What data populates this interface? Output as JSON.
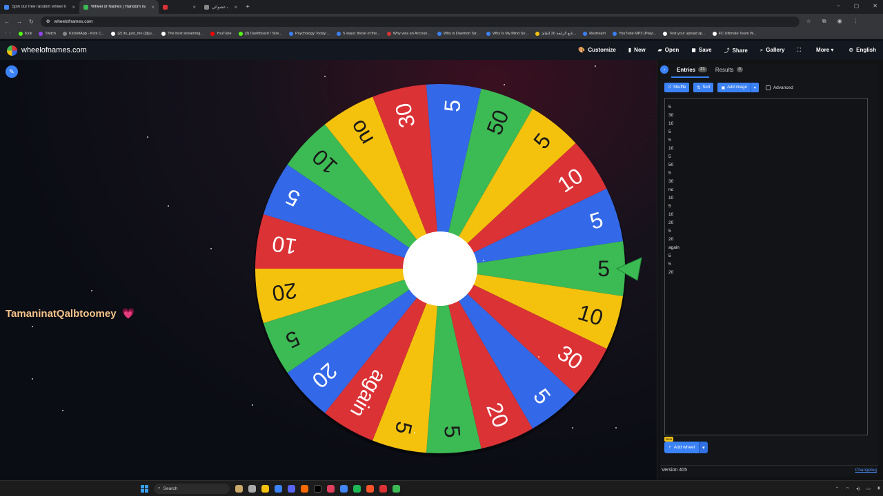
{
  "browser": {
    "tabs": [
      {
        "title": "Spin our free random wheel fo",
        "color": "#4285f4",
        "active": false
      },
      {
        "title": "Wheel of Names | Random nam",
        "color": "#3cba54",
        "active": true
      },
      {
        "title": "",
        "color": "#db3236",
        "active": false
      },
      {
        "title": "سحب عشوائي",
        "color": "#888888",
        "active": false
      }
    ],
    "url": "wheelofnames.com",
    "bookmarks": [
      {
        "label": "Kick",
        "color": "#53fc18"
      },
      {
        "label": "Twitch",
        "color": "#9146ff"
      },
      {
        "label": "KickletApp - Kick C...",
        "color": "#888888"
      },
      {
        "label": "(2) its_just_me (@ju...",
        "color": "#ffffff"
      },
      {
        "label": "The best streaming...",
        "color": "#ffffff"
      },
      {
        "label": "YouTube",
        "color": "#ff0000"
      },
      {
        "label": "(3) Dashboard / Stre...",
        "color": "#53fc18"
      },
      {
        "label": "Psychology Today:...",
        "color": "#3b82f6"
      },
      {
        "label": "5 ways: those of the...",
        "color": "#3b82f6"
      },
      {
        "label": "Why was an Accoun...",
        "color": "#db3236"
      },
      {
        "label": "Why is Daemon Tar...",
        "color": "#3b82f6"
      },
      {
        "label": "Why Is My Mind So...",
        "color": "#3b82f6"
      },
      {
        "label": "تابع الرابعة 20 للقائ...",
        "color": "#f4c20d"
      },
      {
        "label": "Restream",
        "color": "#3b82f6"
      },
      {
        "label": "YouTube MP3 (Playl...",
        "color": "#3b82f6"
      },
      {
        "label": "Test your upload sp...",
        "color": "#ffffff"
      },
      {
        "label": "FC Ultimate Team W...",
        "color": "#ffffff"
      }
    ]
  },
  "app": {
    "logo_text": "wheelofnames.com",
    "menu": [
      {
        "icon": "palette-icon",
        "glyph": "🎨",
        "label": "Customize"
      },
      {
        "icon": "file-icon",
        "glyph": "▮",
        "label": "New"
      },
      {
        "icon": "folder-icon",
        "glyph": "▰",
        "label": "Open"
      },
      {
        "icon": "save-icon",
        "glyph": "◼",
        "label": "Save"
      },
      {
        "icon": "share-icon",
        "glyph": "⤴",
        "label": "Share"
      },
      {
        "icon": "search-icon",
        "glyph": "⌕",
        "label": "Gallery"
      },
      {
        "icon": "fullscreen-icon",
        "glyph": "⛶",
        "label": ""
      },
      {
        "icon": "chevron-down-icon",
        "glyph": "▾",
        "label": "More"
      },
      {
        "icon": "globe-icon",
        "glyph": "⊕",
        "label": "English"
      }
    ]
  },
  "stage": {
    "username": "TamaninatQalbtoomey",
    "heart": "💗"
  },
  "wheel": {
    "colors": [
      "#3369e8",
      "#3cba54",
      "#f4c20d",
      "#db3236"
    ],
    "segments": [
      {
        "text": "5",
        "color": "#3cba54"
      },
      {
        "text": "10",
        "color": "#f4c20d"
      },
      {
        "text": "30",
        "color": "#db3236"
      },
      {
        "text": "5",
        "color": "#3369e8"
      },
      {
        "text": "20",
        "color": "#db3236"
      },
      {
        "text": "5",
        "color": "#3cba54"
      },
      {
        "text": "5",
        "color": "#f4c20d"
      },
      {
        "text": "again",
        "color": "#db3236"
      },
      {
        "text": "20",
        "color": "#3369e8"
      },
      {
        "text": "5",
        "color": "#3cba54"
      },
      {
        "text": "20",
        "color": "#f4c20d"
      },
      {
        "text": "10",
        "color": "#db3236"
      },
      {
        "text": "5",
        "color": "#3369e8"
      },
      {
        "text": "10",
        "color": "#3cba54"
      },
      {
        "text": "no",
        "color": "#f4c20d"
      },
      {
        "text": "30",
        "color": "#db3236"
      },
      {
        "text": "5",
        "color": "#3369e8"
      },
      {
        "text": "50",
        "color": "#3cba54"
      },
      {
        "text": "5",
        "color": "#f4c20d"
      },
      {
        "text": "10",
        "color": "#db3236"
      },
      {
        "text": "5",
        "color": "#3369e8"
      }
    ],
    "pointer_color": "#3cba54"
  },
  "panel": {
    "tabs": [
      {
        "label": "Entries",
        "count": "21"
      },
      {
        "label": "Results",
        "count": "0"
      }
    ],
    "toolbar": {
      "shuffle": "Shuffle",
      "sort": "Sort",
      "add_image": "Add image",
      "advanced": "Advanced"
    },
    "entries": [
      "5",
      "30",
      "10",
      "5",
      "5",
      "10",
      "5",
      "50",
      "5",
      "30",
      "no",
      "10",
      "5",
      "10",
      "20",
      "5",
      "20",
      "again",
      "5",
      "5",
      "20"
    ],
    "add_wheel": "Add wheel",
    "beta": "Beta",
    "version": "Version 405",
    "changelog": "Changelog"
  },
  "taskbar": {
    "search_label": "Search"
  }
}
